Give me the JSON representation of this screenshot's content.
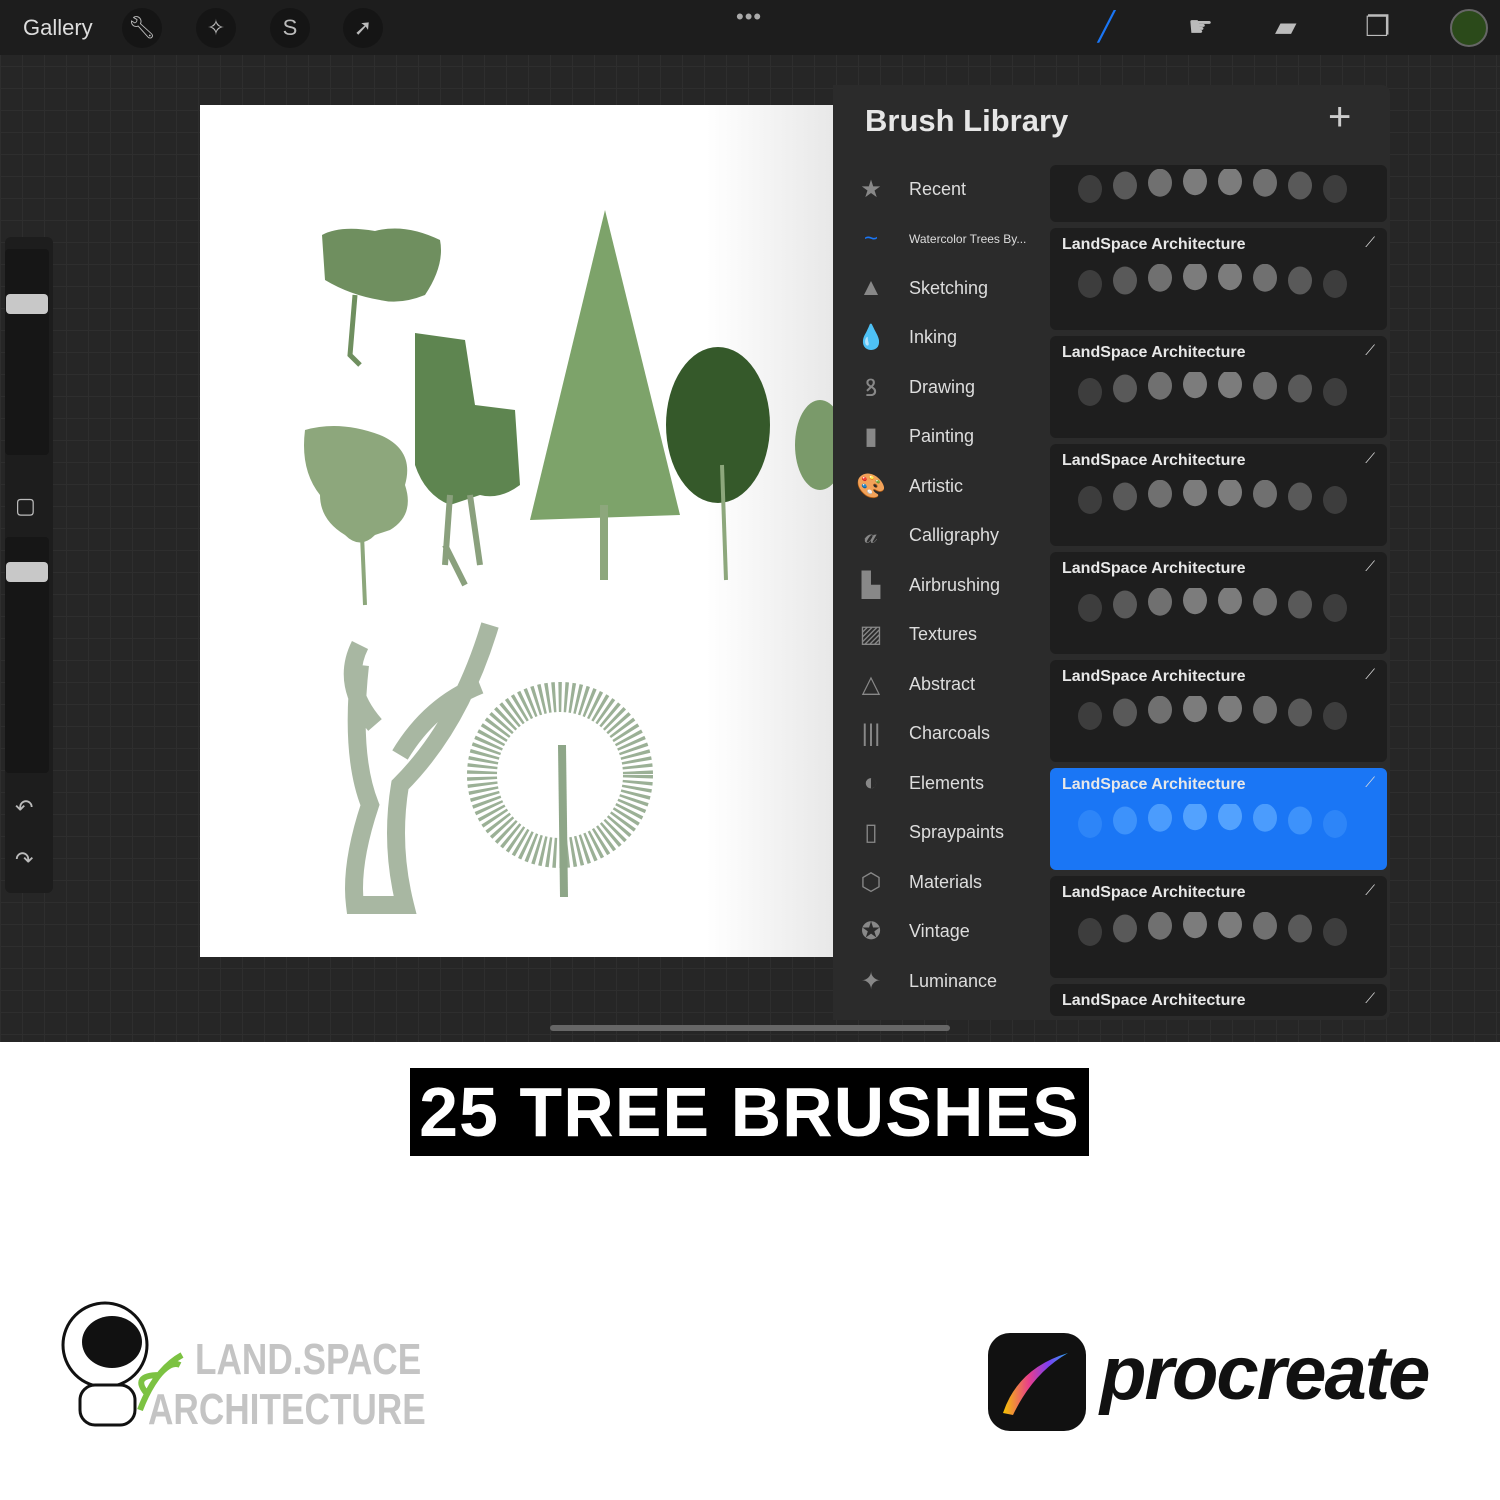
{
  "topbar": {
    "gallery": "Gallery",
    "left_tools": [
      "wrench-icon",
      "magic-wand-icon",
      "selection-icon",
      "transform-arrow-icon"
    ],
    "right_tools": [
      "brush-icon",
      "smudge-icon",
      "eraser-icon",
      "layers-icon"
    ],
    "color": "#2b4a1a",
    "accent": "#1a76f5"
  },
  "panel": {
    "title": "Brush Library",
    "categories": [
      {
        "label": "Recent",
        "icon": "★"
      },
      {
        "label": "Watercolor Trees By...",
        "icon": "~"
      },
      {
        "label": "Sketching",
        "icon": "▲"
      },
      {
        "label": "Inking",
        "icon": "💧"
      },
      {
        "label": "Drawing",
        "icon": "ꝸ"
      },
      {
        "label": "Painting",
        "icon": "▮"
      },
      {
        "label": "Artistic",
        "icon": "🎨"
      },
      {
        "label": "Calligraphy",
        "icon": "𝒶"
      },
      {
        "label": "Airbrushing",
        "icon": "▙"
      },
      {
        "label": "Textures",
        "icon": "▨"
      },
      {
        "label": "Abstract",
        "icon": "△"
      },
      {
        "label": "Charcoals",
        "icon": "|||"
      },
      {
        "label": "Elements",
        "icon": "◐"
      },
      {
        "label": "Spraypaints",
        "icon": "▯"
      },
      {
        "label": "Materials",
        "icon": "⬡"
      },
      {
        "label": "Vintage",
        "icon": "✪"
      },
      {
        "label": "Luminance",
        "icon": "✦"
      }
    ],
    "brushes": [
      {
        "name": ""
      },
      {
        "name": "LandSpace Architecture"
      },
      {
        "name": "LandSpace Architecture"
      },
      {
        "name": "LandSpace Architecture"
      },
      {
        "name": "LandSpace Architecture"
      },
      {
        "name": "LandSpace Architecture"
      },
      {
        "name": "LandSpace Architecture",
        "selected": true
      },
      {
        "name": "LandSpace Architecture"
      },
      {
        "name": "LandSpace Architecture"
      }
    ]
  },
  "banner": "25 TREE BRUSHES",
  "logo_left": {
    "line1": "LAND.SPACE",
    "line2": "ARCHITECTURE"
  },
  "logo_right": "procreate"
}
